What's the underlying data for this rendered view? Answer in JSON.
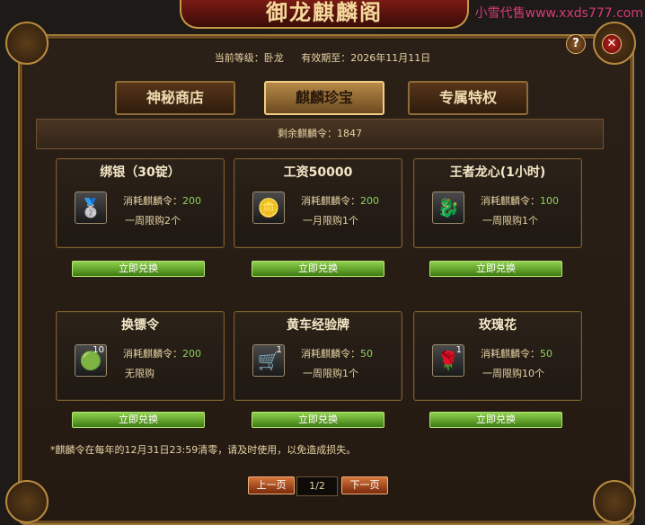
{
  "watermark": "小雪代售www.xxds777.com",
  "window": {
    "title": "御龙麒麟阁",
    "current_level_label": "当前等级：卧龙",
    "expiry_label": "有效期至：2026年11月11日"
  },
  "tabs": [
    {
      "label": "神秘商店",
      "active": false
    },
    {
      "label": "麒麟珍宝",
      "active": true
    },
    {
      "label": "专属特权",
      "active": false
    }
  ],
  "remaining": "剩余麒麟令：1847",
  "cost_label": "消耗麒麟令：",
  "redeem_label": "立即兑换",
  "items": [
    {
      "name": "绑银（30锭）",
      "icon": "silver-ingot-icon",
      "cost": "200",
      "limit": "一周限购2个",
      "count": ""
    },
    {
      "name": "工资50000",
      "icon": "gold-coins-icon",
      "cost": "200",
      "limit": "一月限购1个",
      "count": ""
    },
    {
      "name": "王者龙心(1小时)",
      "icon": "dragon-head-icon",
      "cost": "100",
      "limit": "一周限购1个",
      "count": ""
    },
    {
      "name": "换镖令",
      "icon": "escort-token-icon",
      "cost": "200",
      "limit": "无限购",
      "count": "10"
    },
    {
      "name": "黄车经验牌",
      "icon": "yellow-cart-icon",
      "cost": "50",
      "limit": "一周限购1个",
      "count": "1"
    },
    {
      "name": "玫瑰花",
      "icon": "rose-icon",
      "cost": "50",
      "limit": "一周限购10个",
      "count": "1"
    }
  ],
  "notice": "*麒麟令在每年的12月31日23:59清零，请及时使用，以免造成损失。",
  "pager": {
    "prev_label": "上一页",
    "page": "1/2",
    "next_label": "下一页"
  },
  "help_label": "?",
  "close_label": "✕",
  "colors": {
    "accent_gold": "#c59945",
    "cost_green": "#8fd25d",
    "button_green": "#5fa62a",
    "pager_orange": "#b8502a"
  }
}
